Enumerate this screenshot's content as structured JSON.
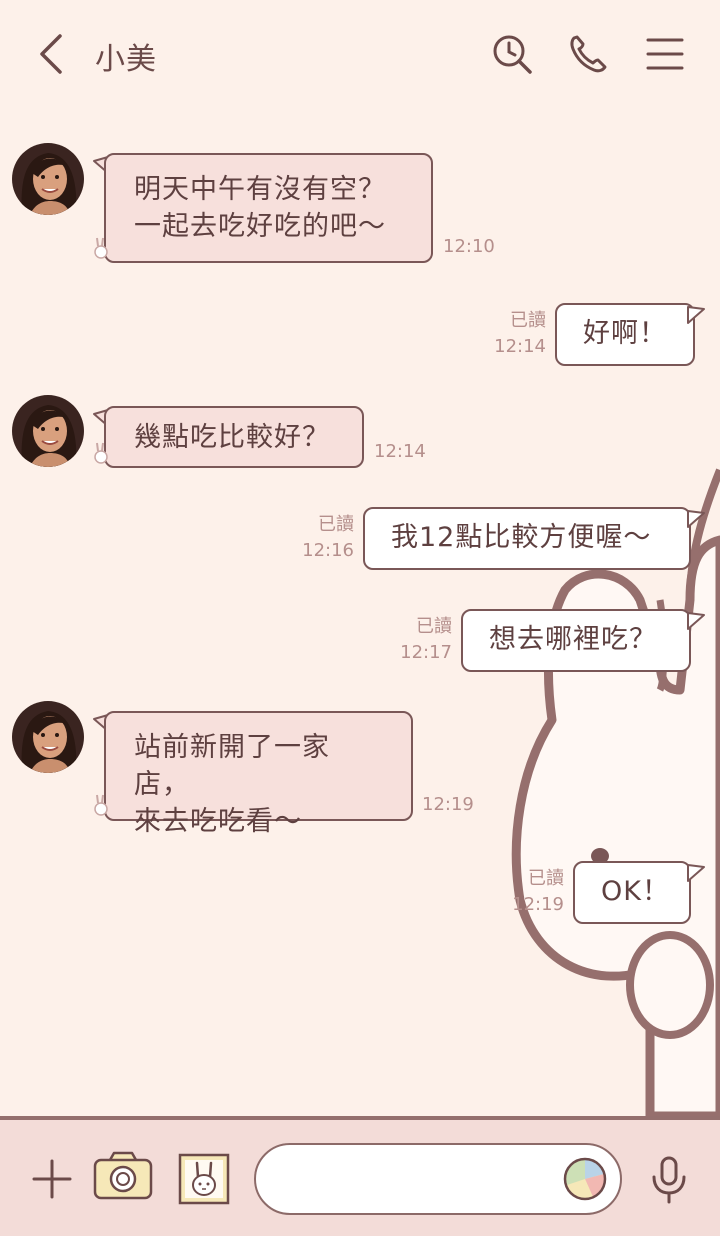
{
  "header": {
    "title": "小美",
    "back_icon": "chevron-left-icon",
    "search_icon": "search-icon",
    "call_icon": "phone-icon",
    "menu_icon": "menu-icon"
  },
  "messages": [
    {
      "from": "contact",
      "text": "明天中午有沒有空？\n一起去吃好吃的吧～",
      "time": "12:10"
    },
    {
      "from": "me",
      "text": "好啊！",
      "read": "已讀",
      "time": "12:14"
    },
    {
      "from": "contact",
      "text": "幾點吃比較好？",
      "time": "12:14"
    },
    {
      "from": "me",
      "text": "我12點比較方便喔～",
      "read": "已讀",
      "time": "12:16"
    },
    {
      "from": "me",
      "text": "想去哪裡吃？",
      "read": "已讀",
      "time": "12:17"
    },
    {
      "from": "contact",
      "text": "站前新開了一家店，\n來去吃吃看～",
      "time": "12:19"
    },
    {
      "from": "me",
      "text": "OK！",
      "read": "已讀",
      "time": "12:19"
    }
  ],
  "input": {
    "placeholder": "",
    "value": ""
  },
  "bottom_icons": [
    "plus-icon",
    "camera-icon",
    "sticker-icon",
    "emoji-icon",
    "mic-icon"
  ],
  "colors": {
    "background": "#fdf1ea",
    "incoming_bubble": "#f7e0dc",
    "outgoing_bubble": "#ffffff",
    "outline": "#7a5757",
    "meta_text": "#b58f8c",
    "bottom_bar": "#f3dcd8"
  }
}
